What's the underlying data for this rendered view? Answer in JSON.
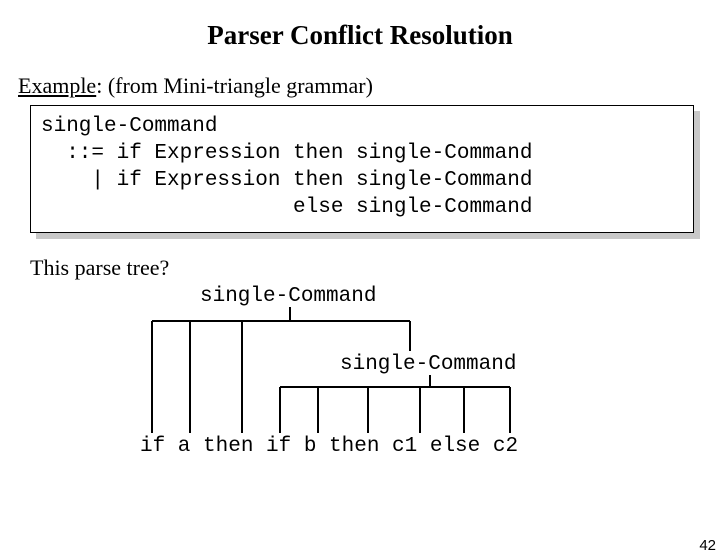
{
  "title": "Parser Conflict Resolution",
  "exampleLabel": "Example",
  "exampleText": ": (from Mini-triangle grammar)",
  "grammar": "single-Command\n  ::= if Expression then single-Command\n    | if Expression then single-Command\n                    else single-Command",
  "question": "This parse tree?",
  "tree": {
    "root": "single-Command",
    "inner": "single-Command",
    "tokens": "if a then if b then c1 else c2"
  },
  "pagenum": "42"
}
